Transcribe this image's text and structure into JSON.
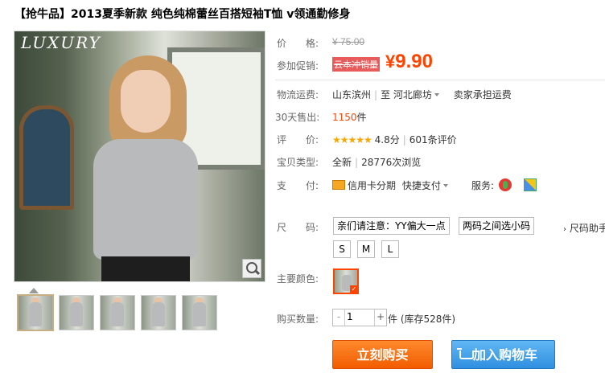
{
  "product": {
    "title": "【抢牛品】2013夏季新款 纯色纯棉蕾丝百搭短袖T恤 v领通勤修身",
    "image_logo": "LUXURY"
  },
  "price": {
    "label": "价　　格:",
    "original": "¥ 75.00",
    "promo_label": "参加促销:",
    "promo_tag": "云本冲销量",
    "promo_currency": "¥",
    "promo_value": "9.90"
  },
  "shipping": {
    "label": "物流运费:",
    "from": "山东滨州",
    "to_label": "至",
    "to": "河北廊坊",
    "fee": "卖家承担运费"
  },
  "sales": {
    "label": "30天售出:",
    "count": "1150",
    "unit": "件"
  },
  "rating": {
    "label": "评　　价:",
    "stars": "★★★★★",
    "score": "4.8分",
    "reviews": "601条评价"
  },
  "item_type": {
    "label": "宝贝类型:",
    "condition": "全新",
    "views": "28776次浏览"
  },
  "payment": {
    "label": "支　　付:",
    "installment": "信用卡分期",
    "quick": "快捷支付",
    "service_label": "服务:",
    "icons": [
      "guarantee-icon",
      "seven-day-return-icon"
    ]
  },
  "size": {
    "label": "尺　　码:",
    "note_primary": "亲们请注意：YY偏大一点",
    "note_secondary": "两码之间选小码",
    "helper": "尺码助手",
    "options": [
      "S",
      "M",
      "L"
    ]
  },
  "color": {
    "label": "主要颜色:",
    "check": "✓"
  },
  "quantity": {
    "label": "购买数量:",
    "minus": "-",
    "value": "1",
    "plus": "+",
    "unit": "件",
    "stock": "(库存528件)"
  },
  "actions": {
    "buy": "立刻购买",
    "cart": "加入购物车"
  }
}
